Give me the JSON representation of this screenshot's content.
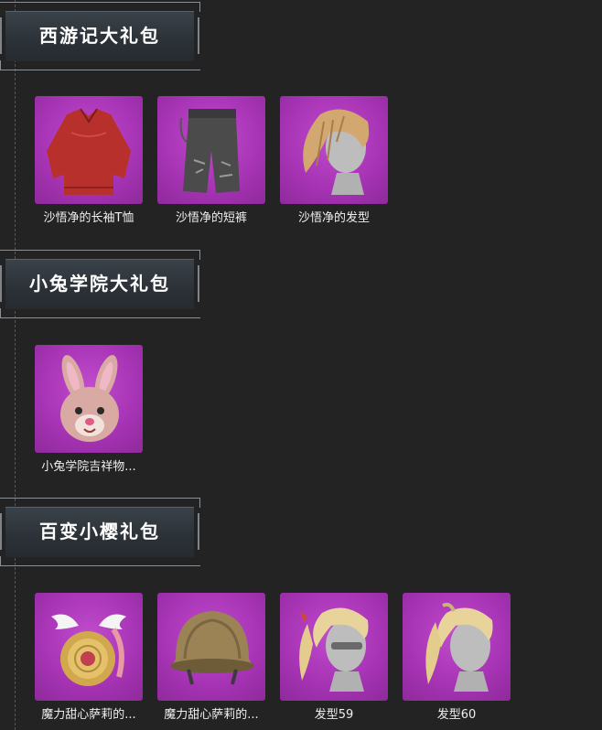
{
  "sections": [
    {
      "title": "西游记大礼包",
      "items": [
        {
          "label": "沙悟净的长袖T恤",
          "icon": "red-shirt-icon"
        },
        {
          "label": "沙悟净的短裤",
          "icon": "shorts-icon"
        },
        {
          "label": "沙悟净的发型",
          "icon": "hairstyle-icon"
        }
      ]
    },
    {
      "title": "小兔学院大礼包",
      "items": [
        {
          "label": "小兔学院吉祥物...",
          "icon": "rabbit-mascot-icon"
        }
      ]
    },
    {
      "title": "百变小樱礼包",
      "items": [
        {
          "label": "魔力甜心萨莉的...",
          "icon": "winged-backpack-icon"
        },
        {
          "label": "魔力甜心萨莉的...",
          "icon": "helmet-icon"
        },
        {
          "label": "发型59",
          "icon": "hairstyle-icon"
        },
        {
          "label": "发型60",
          "icon": "hairstyle-icon"
        }
      ]
    }
  ],
  "colors": {
    "background": "#232323",
    "item_card": "#a834b6",
    "header_plate": "#2f363c"
  }
}
